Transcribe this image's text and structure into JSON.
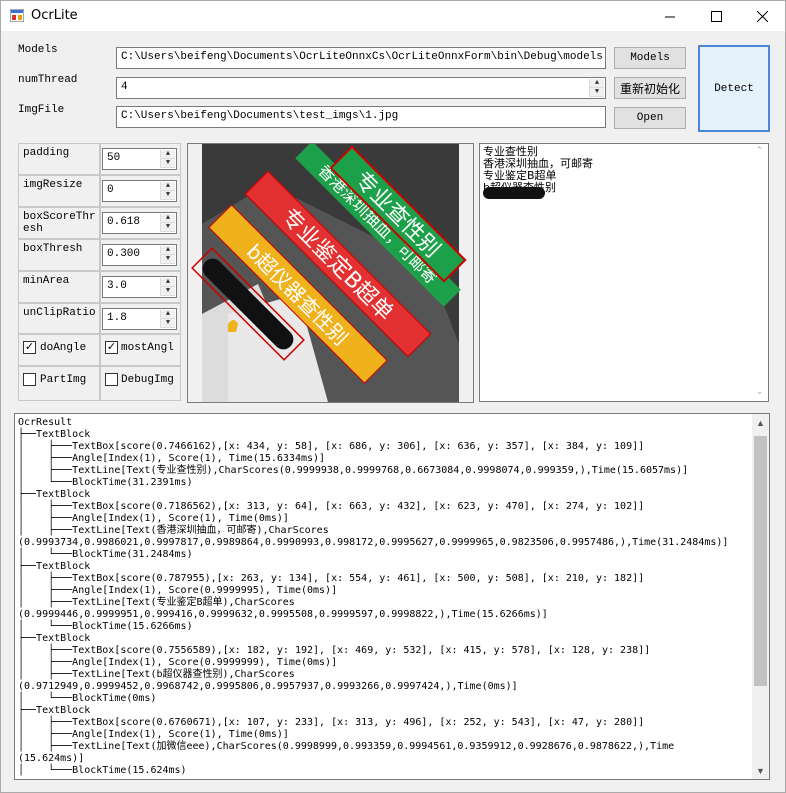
{
  "window": {
    "title": "OcrLite",
    "icon": "app-window-icon"
  },
  "models": {
    "label": "Models",
    "value": "C:\\Users\\beifeng\\Documents\\OcrLiteOnnxCs\\OcrLiteOnnxForm\\bin\\Debug\\models",
    "button": "Models"
  },
  "numThread": {
    "label": "numThread",
    "value": "4",
    "button": "重新初始化"
  },
  "imgFile": {
    "label": "ImgFile",
    "value": "C:\\Users\\beifeng\\Documents\\test_imgs\\1.jpg",
    "button": "Open"
  },
  "detect": {
    "label": "Detect"
  },
  "params": [
    {
      "label": "padding",
      "value": "50"
    },
    {
      "label": "imgResize",
      "value": "0"
    },
    {
      "label": "boxScoreThresh",
      "value": "0.618"
    },
    {
      "label": "boxThresh",
      "value": "0.300"
    },
    {
      "label": "minArea",
      "value": "3.0"
    },
    {
      "label": "unClipRatio",
      "value": "1.8"
    }
  ],
  "checks": {
    "doAngle": {
      "label": "doAngle",
      "checked": true
    },
    "mostAngle": {
      "label": "mostAngl",
      "checked": true
    },
    "partImg": {
      "label": "PartImg",
      "checked": false
    },
    "debugImg": {
      "label": "DebugImg",
      "checked": false
    }
  },
  "image": {
    "stickers": [
      "专业查性别",
      "香港深圳抽血，可邮寄",
      "专业鉴定B超单",
      "b超仪器查性别"
    ]
  },
  "result_lines": [
    "专业查性别",
    "香港深圳抽血，可邮寄",
    "专业鉴定B超单",
    "b超仪器查性别"
  ],
  "tree_lines": [
    "OcrResult",
    "├──TextBlock",
    "│    ├───TextBox[score(0.7466162),[x: 434, y: 58], [x: 686, y: 306], [x: 636, y: 357], [x: 384, y: 109]]",
    "│    ├───Angle[Index(1), Score(1), Time(15.6334ms)]",
    "│    ├───TextLine[Text(专业查性别),CharScores(0.9999938,0.9999768,0.6673084,0.9998074,0.999359,),Time(15.6057ms)]",
    "│    └───BlockTime(31.2391ms)",
    "├──TextBlock",
    "│    ├───TextBox[score(0.7186562),[x: 313, y: 64], [x: 663, y: 432], [x: 623, y: 470], [x: 274, y: 102]]",
    "│    ├───Angle[Index(1), Score(1), Time(0ms)]",
    "│    ├───TextLine[Text(香港深圳抽血，可邮寄),CharScores",
    "(0.9993734,0.9986021,0.9997817,0.9989864,0.9990993,0.998172,0.9995627,0.9999965,0.9823506,0.9957486,),Time(31.2484ms)]",
    "│    └───BlockTime(31.2484ms)",
    "├──TextBlock",
    "│    ├───TextBox[score(0.787955),[x: 263, y: 134], [x: 554, y: 461], [x: 500, y: 508], [x: 210, y: 182]]",
    "│    ├───Angle[Index(1), Score(0.9999995), Time(0ms)]",
    "│    ├───TextLine[Text(专业鉴定B超单),CharScores",
    "(0.9999446,0.9999951,0.999416,0.9999632,0.9995508,0.9999597,0.9998822,),Time(15.6266ms)]",
    "│    └───BlockTime(15.6266ms)",
    "├──TextBlock",
    "│    ├───TextBox[score(0.7556589),[x: 182, y: 192], [x: 469, y: 532], [x: 415, y: 578], [x: 128, y: 238]]",
    "│    ├───Angle[Index(1), Score(0.9999999), Time(0ms)]",
    "│    ├───TextLine[Text(b超仪器查性别),CharScores",
    "(0.9712949,0.9999452,0.9968742,0.9995806,0.9957937,0.9993266,0.9997424,),Time(0ms)]",
    "│    └───BlockTime(0ms)",
    "├──TextBlock",
    "│    ├───TextBox[score(0.6760671),[x: 107, y: 233], [x: 313, y: 496], [x: 252, y: 543], [x: 47, y: 280]]",
    "│    ├───Angle[Index(1), Score(1), Time(0ms)]",
    "│    ├───TextLine[Text(加微信eee),CharScores(0.9998999,0.993359,0.9994561,0.9359912,0.9928676,0.9878622,),Time",
    "(15.624ms)]",
    "│    └───BlockTime(15.624ms)"
  ]
}
